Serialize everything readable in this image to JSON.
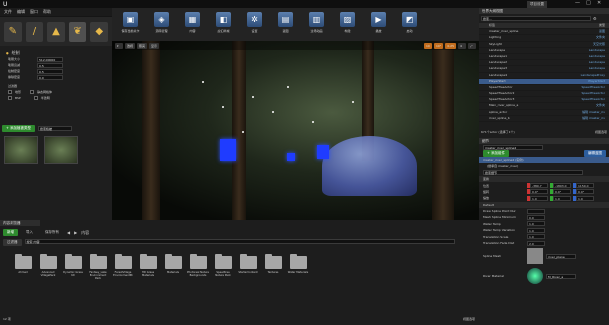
{
  "app": {
    "title": "",
    "window_controls": [
      "—",
      "□",
      "✕"
    ],
    "top_right_label": "项目设置"
  },
  "menu": {
    "items": [
      "文件",
      "编辑",
      "窗口",
      "帮助"
    ]
  },
  "modes": {
    "panel_title": "模式",
    "search_placeholder": ""
  },
  "toolbar": {
    "buttons": [
      {
        "label": "保存当前关卡"
      },
      {
        "label": "源码管理"
      },
      {
        "label": "内容"
      },
      {
        "label": "虚幻商城"
      },
      {
        "label": "设置"
      },
      {
        "label": "蓝图"
      },
      {
        "label": "过场动画"
      },
      {
        "label": "构建"
      },
      {
        "label": "播放"
      },
      {
        "label": "启动"
      }
    ]
  },
  "viewport": {
    "mode_buttons": [
      "透视",
      "照亮",
      "显示"
    ],
    "grid_value": "10",
    "angle_value": "10°",
    "scale_value": "0.25",
    "speed": "4"
  },
  "left_panel": {
    "title": "绘制",
    "rows": [
      {
        "label": "笔刷大小",
        "value": "512.00000"
      },
      {
        "label": "笔刷衰减",
        "value": "0.5"
      },
      {
        "label": "绘制密度",
        "value": "0.5"
      },
      {
        "label": "擦除密度",
        "value": "0.0"
      }
    ],
    "filters_title": "过滤器",
    "filters": [
      "地形",
      "静态网格体",
      "BSP",
      "半透明"
    ],
    "foliage_label": "+ 添加植被类型",
    "search_placeholder": "搜索植被"
  },
  "outliner": {
    "title": "世界大纲视图",
    "search_placeholder": "搜索...",
    "col_label": "标签",
    "col_type": "类型",
    "rows": [
      {
        "name": "master_river_spline",
        "type": "蓝图",
        "sel": false
      },
      {
        "name": "Lighting",
        "type": "文件夹",
        "sel": false
      },
      {
        "name": "SkyLight",
        "type": "天空光照",
        "sel": false
      },
      {
        "name": "Landscape",
        "type": "Landscape",
        "sel": false
      },
      {
        "name": "Landscape1",
        "type": "Landscape",
        "sel": false
      },
      {
        "name": "Landscape2",
        "type": "Landscape",
        "sel": false
      },
      {
        "name": "Landscape3",
        "type": "Landscape",
        "sel": false
      },
      {
        "name": "Landscape4",
        "type": "LandscapeProxy",
        "sel": false
      },
      {
        "name": "PlayerStart",
        "type": "PlayerStart",
        "sel": true
      },
      {
        "name": "SpeedTreeActor",
        "type": "SpeedTreeActor",
        "sel": false
      },
      {
        "name": "SpeedTreeActor2",
        "type": "SpeedTreeActor",
        "sel": false
      },
      {
        "name": "SpeedTreeActor3",
        "type": "SpeedTreeActor",
        "sel": false
      },
      {
        "name": "Main_river_spline_a",
        "type": "文件夹",
        "sel": false
      },
      {
        "name": "spline_actor",
        "type": "编辑 master_riv",
        "sel": false
      },
      {
        "name": "river_spline_b",
        "type": "编辑 master_riv",
        "sel": false
      }
    ],
    "footer_count": "671个actor (选择了1个)",
    "footer_view": "视图选项"
  },
  "details": {
    "title": "细节",
    "actor_name": "master_river_spline2",
    "add_component": "+ 添加组件",
    "blueprint_btn": "编辑蓝图",
    "component_root": "master_river_spline2 (实例)",
    "component_child": "(继承自 master_river)",
    "search_placeholder": "搜索细节",
    "transform_title": "变换",
    "location": {
      "label": "位置",
      "x": "-380.7",
      "y": "-1803.0",
      "z": "1150.0"
    },
    "rotation": {
      "label": "旋转",
      "x": "0.0°",
      "y": "0.0°",
      "z": "0.0°"
    },
    "scale": {
      "label": "缩放",
      "x": "1.0",
      "y": "1.0",
      "z": "1.0"
    },
    "default_title": "Default",
    "props": [
      {
        "label": "Draw Spline Point Nur",
        "value": ""
      },
      {
        "label": "Mesh Spline Minimum",
        "value": "0.0"
      },
      {
        "label": "Water Temp",
        "value": "1.0"
      },
      {
        "label": "Water Temp Variation",
        "value": "1.0"
      },
      {
        "label": "Translation Scale",
        "value": "1.0"
      },
      {
        "label": "Translation Fade Dist",
        "value": "2.0"
      }
    ],
    "spline_mesh_label": "Spline Mesh",
    "spline_mesh_value": "river_plane",
    "river_material_label": "River Material",
    "river_material_value": "M_River_a"
  },
  "content": {
    "title": "内容浏览器",
    "add_new": "新增",
    "import": "导入",
    "save_all": "保存所有",
    "path": "内容",
    "filter_label": "过滤器",
    "search_placeholder": "搜索 内容",
    "folders": [
      "Ahmad",
      "Advanced VillagePack",
      "Dynamic Grass Kit",
      "Fantasy_Lake Environment Pack",
      "ForestVillage EnvironmentPk",
      "HD Grass Materials",
      "Materials",
      "Photoreal Nature Backgrounds",
      "Speedtree Nature Pack",
      "StarterContent",
      "Textures",
      "Water Materials"
    ],
    "footer_items": "12 项",
    "footer_view": "视图选项"
  },
  "colors": {
    "accent": "#c26c1c",
    "selection": "#3a5b8c",
    "link_green": "#2e8b2e"
  }
}
